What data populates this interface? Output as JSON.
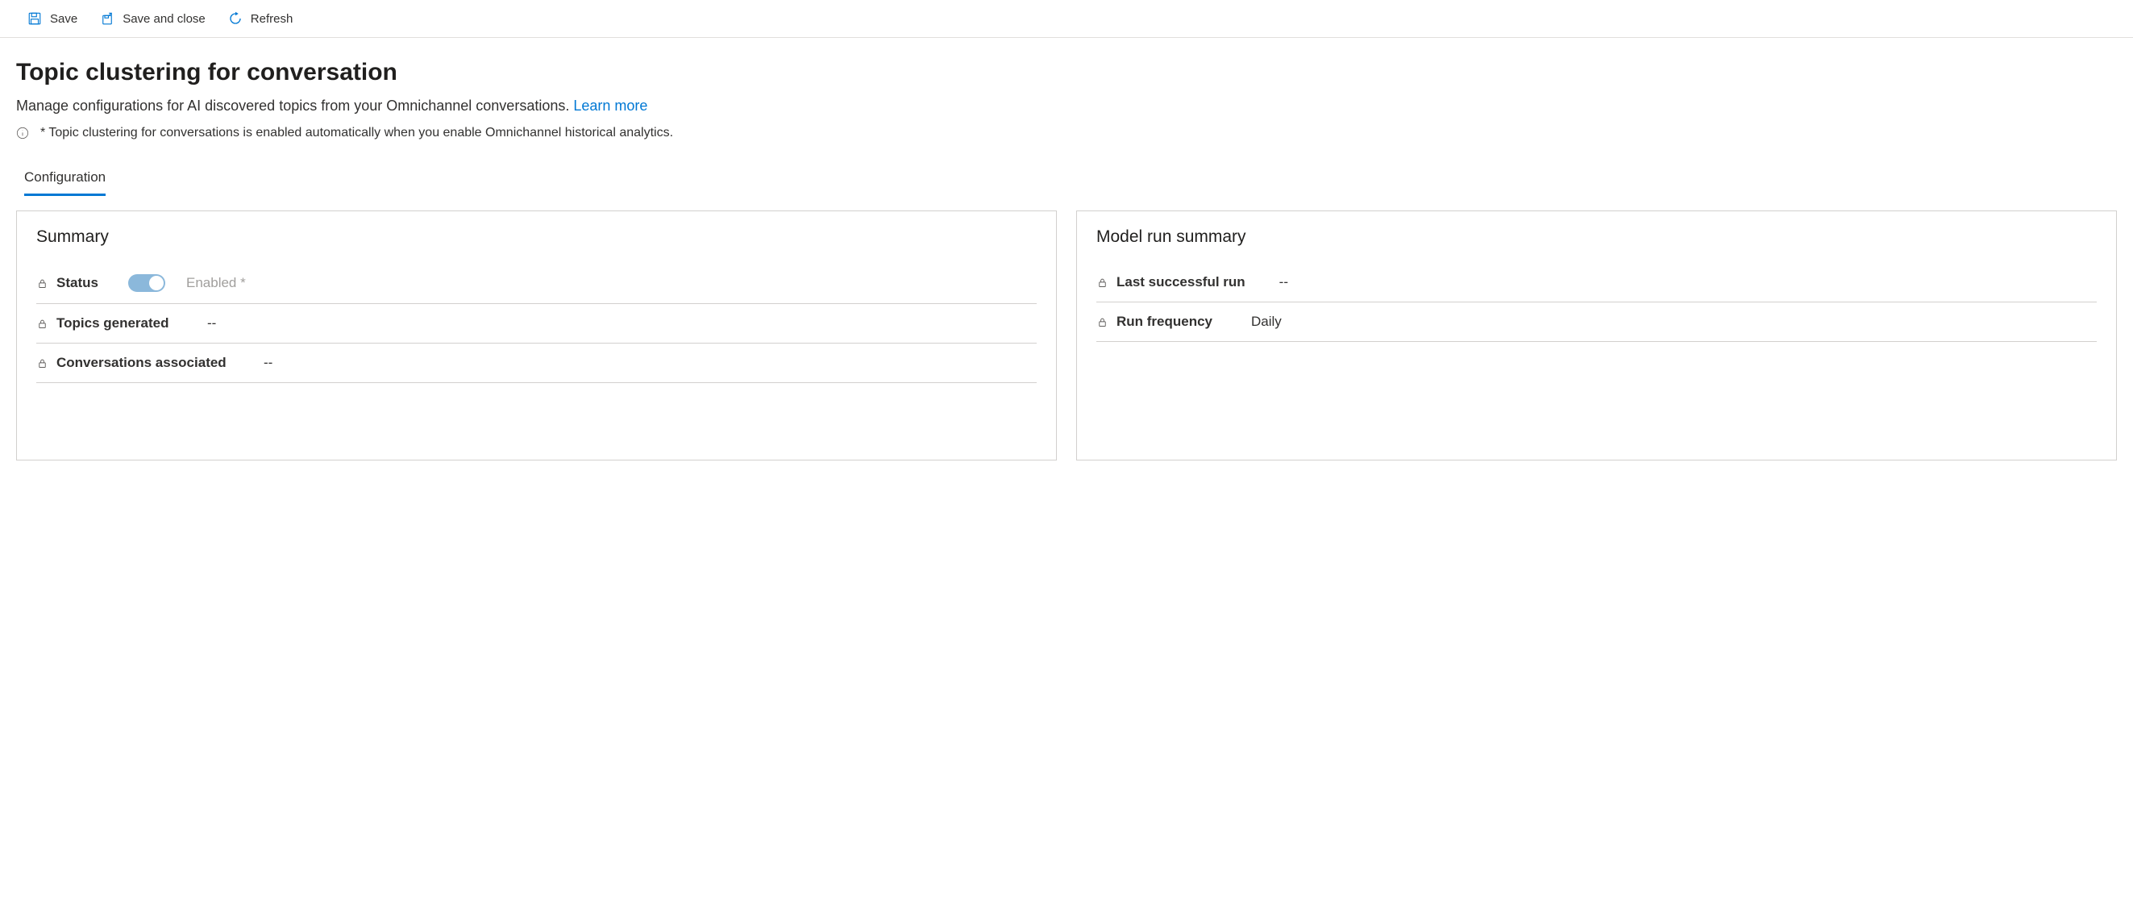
{
  "toolbar": {
    "save_label": "Save",
    "save_close_label": "Save and close",
    "refresh_label": "Refresh"
  },
  "header": {
    "title": "Topic clustering for conversation",
    "description": "Manage configurations for AI discovered topics from your Omnichannel conversations. ",
    "learn_more": "Learn more",
    "info_note": "* Topic clustering for conversations is enabled automatically when you enable Omnichannel historical analytics."
  },
  "tabs": [
    {
      "label": "Configuration",
      "active": true
    }
  ],
  "summary_card": {
    "heading": "Summary",
    "fields": {
      "status_label": "Status",
      "status_toggle_text": "Enabled *",
      "topics_label": "Topics generated",
      "topics_value": "--",
      "conversations_label": "Conversations associated",
      "conversations_value": "--"
    }
  },
  "model_card": {
    "heading": "Model run summary",
    "fields": {
      "last_run_label": "Last successful run",
      "last_run_value": "--",
      "frequency_label": "Run frequency",
      "frequency_value": "Daily"
    }
  }
}
